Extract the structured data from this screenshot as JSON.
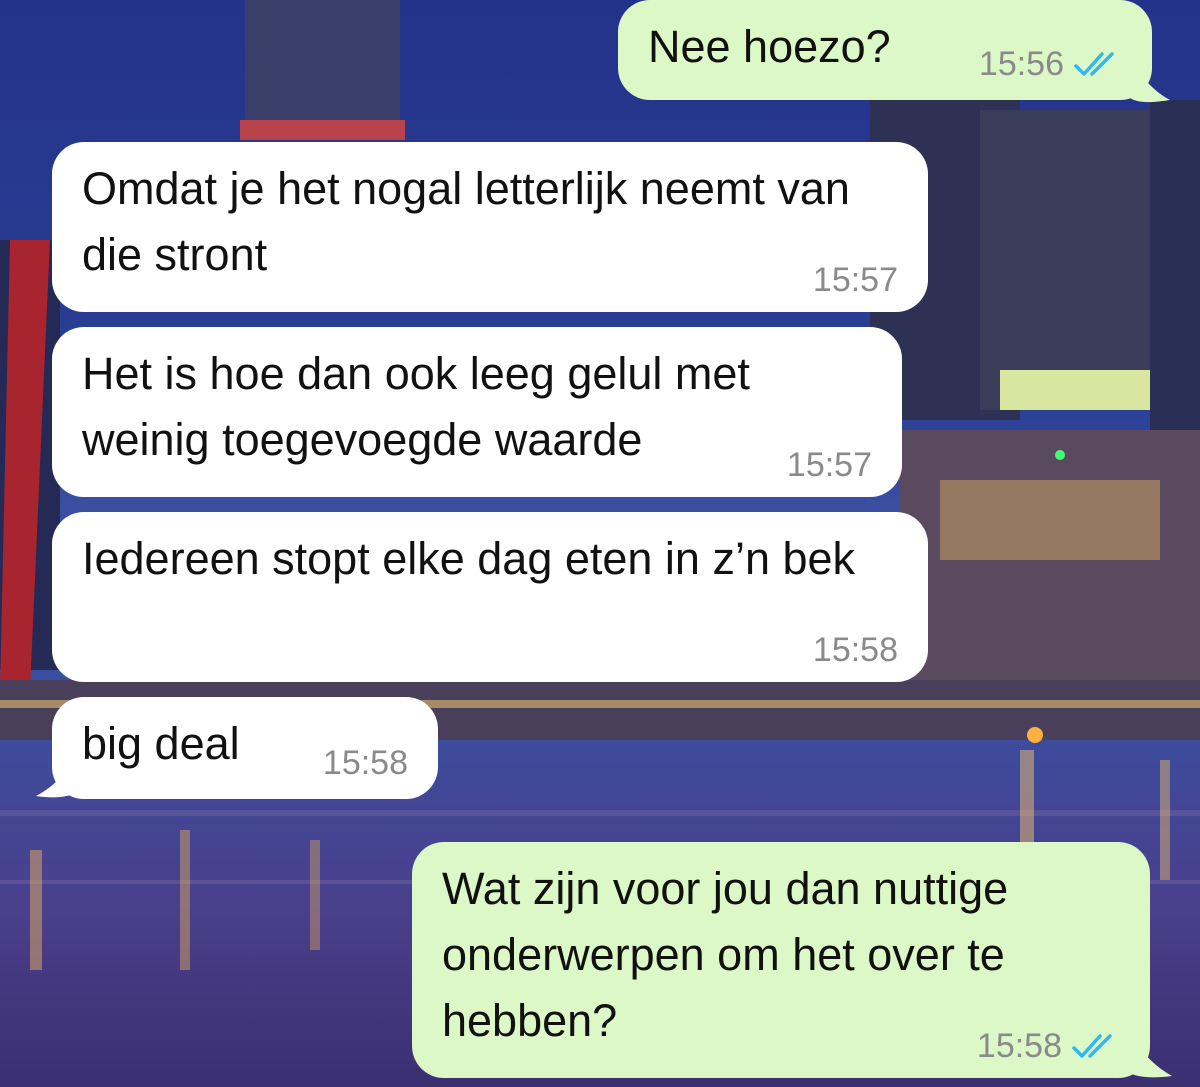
{
  "messages": [
    {
      "direction": "outgoing",
      "text": "Nee hoezo?",
      "time": "15:56",
      "status": "read"
    },
    {
      "direction": "incoming",
      "text": "Omdat je het nogal letterlijk neemt van die stront",
      "time": "15:57"
    },
    {
      "direction": "incoming",
      "text": "Het is hoe dan ook leeg gelul met weinig toegevoegde waarde",
      "time": "15:57"
    },
    {
      "direction": "incoming",
      "text": "Iedereen stopt elke dag eten in z’n bek",
      "time": "15:58"
    },
    {
      "direction": "incoming",
      "text": "big deal",
      "time": "15:58"
    },
    {
      "direction": "outgoing",
      "text": "Wat zijn voor jou dan nuttige onderwerpen om het over te hebben?",
      "time": "15:58",
      "status": "read"
    }
  ],
  "colors": {
    "incoming_bubble": "#ffffff",
    "outgoing_bubble": "#dcf8c6",
    "read_ticks": "#34b7f1",
    "timestamp": "#8a8a8a"
  },
  "icons": {
    "read_status": "double-check-icon"
  }
}
